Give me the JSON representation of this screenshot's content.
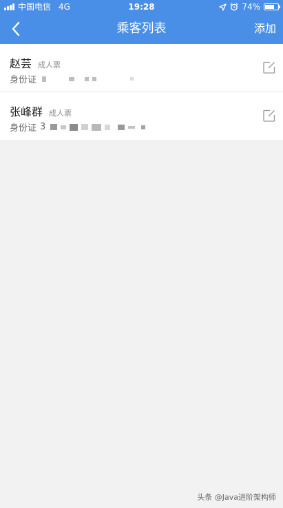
{
  "status_bar": {
    "carrier": "中国电信",
    "network": "4G",
    "time": "19:28",
    "battery_text": "74%",
    "battery_level": 0.74
  },
  "nav": {
    "back_icon": "chevron-left-icon",
    "title": "乘客列表",
    "add_label": "添加"
  },
  "passengers": [
    {
      "name": "赵芸",
      "ticket_type": "成人票",
      "id_label": "身份证",
      "id_visible": "",
      "edit_icon": "edit-icon"
    },
    {
      "name": "张峰群",
      "ticket_type": "成人票",
      "id_label": "身份证",
      "id_visible": "3",
      "edit_icon": "edit-icon"
    }
  ],
  "watermark": "头条 @Java进阶架构师",
  "colors": {
    "brand": "#4a8fe7",
    "background": "#f2f2f2"
  }
}
